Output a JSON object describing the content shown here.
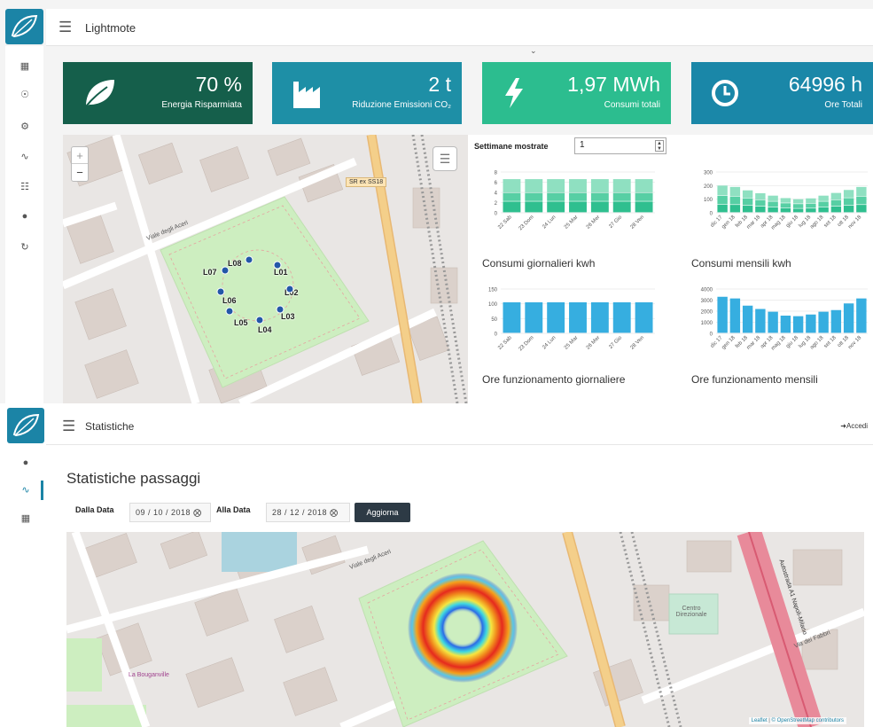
{
  "top": {
    "brand": "Lightmote",
    "kpis": [
      {
        "value": "70 %",
        "label": "Energia Risparmiata",
        "color": "#155f4b",
        "icon": "leaf-icon"
      },
      {
        "value": "2 t",
        "label": "Riduzione Emissioni CO₂",
        "color": "#1e8fa6",
        "icon": "factory-icon"
      },
      {
        "value": "1,97 MWh",
        "label": "Consumi totali",
        "color": "#2cbd8f",
        "icon": "bolt-icon"
      },
      {
        "value": "64996 h",
        "label": "Ore Totali",
        "color": "#1a87a8",
        "icon": "clock-icon"
      }
    ],
    "map": {
      "road_label_1": "Viale degli Aceri",
      "road_label_2": "SR ex SS18",
      "zoom_in": "+",
      "zoom_out": "−",
      "lamps": [
        "L07",
        "L08",
        "L01",
        "L02",
        "L06",
        "L05",
        "L04",
        "L03"
      ]
    },
    "weeks": {
      "label": "Settimane mostrate",
      "value": "1"
    },
    "charts": {
      "daily_consumption": {
        "title": "Consumi giornalieri kwh",
        "type": "bar",
        "categories": [
          "22 Sab",
          "23 Dom",
          "24 Lun",
          "25 Mar",
          "26 Mer",
          "27 Gio",
          "28 Ven"
        ],
        "yticks": [
          "0",
          "2",
          "4",
          "6",
          "8"
        ],
        "ylim": [
          0,
          8
        ],
        "series": [
          {
            "values": [
              2.2,
              2.2,
              2.2,
              2.2,
              2.2,
              2.2,
              2.2
            ],
            "color": "#2fbf8f"
          },
          {
            "values": [
              1.7,
              1.7,
              1.7,
              1.7,
              1.7,
              1.7,
              1.7
            ],
            "color": "#57cfa4"
          },
          {
            "values": [
              2.7,
              2.7,
              2.7,
              2.7,
              2.7,
              2.7,
              2.7
            ],
            "color": "#8fe0c1"
          }
        ]
      },
      "monthly_consumption": {
        "title": "Consumi mensili kwh",
        "type": "bar",
        "categories": [
          "dic 17",
          "gen 18",
          "feb 18",
          "mar 18",
          "apr 18",
          "mag 18",
          "giu 18",
          "lug 18",
          "ago 18",
          "set 18",
          "ott 18",
          "nov 18"
        ],
        "yticks": [
          "0",
          "100",
          "200",
          "300"
        ],
        "ylim": [
          0,
          300
        ],
        "series": [
          {
            "values": [
              60,
              58,
              52,
              46,
              40,
              34,
              30,
              32,
              40,
              46,
              52,
              58
            ],
            "color": "#2fbf8f"
          },
          {
            "values": [
              65,
              62,
              55,
              48,
              42,
              36,
              34,
              36,
              42,
              48,
              56,
              62
            ],
            "color": "#57cfa4"
          },
          {
            "values": [
              75,
              70,
              58,
              50,
              44,
              38,
              36,
              38,
              44,
              52,
              60,
              70
            ],
            "color": "#8fe0c1"
          }
        ]
      },
      "daily_hours": {
        "title": "Ore funzionamento giornaliere",
        "type": "bar",
        "categories": [
          "22 Sab",
          "23 Dom",
          "24 Lun",
          "25 Mar",
          "26 Mer",
          "27 Gio",
          "28 Ven"
        ],
        "yticks": [
          "0",
          "50",
          "100",
          "150"
        ],
        "ylim": [
          0,
          150
        ],
        "series": [
          {
            "values": [
              105,
              105,
              105,
              105,
              105,
              105,
              105
            ],
            "color": "#36aee0"
          }
        ]
      },
      "monthly_hours": {
        "title": "Ore funzionamento mensili",
        "type": "bar",
        "categories": [
          "dic 17",
          "gen 18",
          "feb 18",
          "mar 18",
          "apr 18",
          "mag 18",
          "giu 18",
          "lug 18",
          "ago 18",
          "set 18",
          "ott 18",
          "nov 18"
        ],
        "yticks": [
          "0",
          "1000",
          "2000",
          "3000",
          "4000"
        ],
        "ylim": [
          0,
          4000
        ],
        "series": [
          {
            "values": [
              3300,
              3150,
              2500,
              2200,
              1950,
              1600,
              1550,
              1700,
              1950,
              2100,
              2700,
              3150
            ],
            "color": "#36aee0"
          }
        ]
      }
    }
  },
  "bottom": {
    "title": "Statistiche",
    "login": "Accedi",
    "page_title": "Statistiche passaggi",
    "from_label": "Dalla Data",
    "from_value": "09 / 10 / 2018",
    "to_label": "Alla Data",
    "to_value": "28 / 12 / 2018",
    "update_button": "Aggiorna",
    "map": {
      "road_label_1": "Viale degli Aceri",
      "road_label_2": "Autostrada A1 Napoli-Milano",
      "road_label_3": "Via dei Fabbri",
      "poi_label": "La Bouganville",
      "building_label": "Centro Direzionale",
      "attribution_1": "Leaflet",
      "attribution_2": "© OpenStreetMap contributors"
    }
  }
}
